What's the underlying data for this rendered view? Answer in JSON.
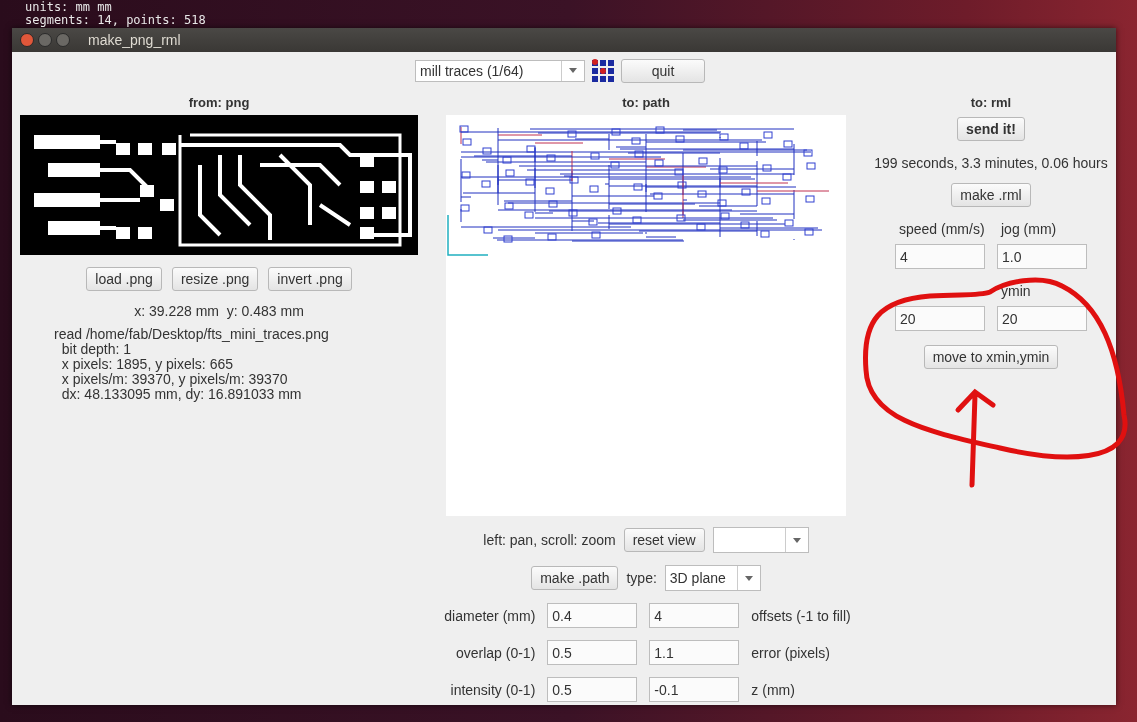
{
  "terminal": {
    "lines": [
      "units: mm mm",
      "segments: 14, points: 518"
    ]
  },
  "window": {
    "title": "make_png_rml"
  },
  "toolbar": {
    "mode_select": {
      "value": "mill traces (1/64)"
    },
    "quit_button": "quit"
  },
  "from_png": {
    "heading": "from: png",
    "buttons": [
      "load .png",
      "resize .png",
      "invert .png"
    ],
    "coords": "x: 39.228 mm  y: 0.483 mm",
    "info_lines": [
      "read /home/fab/Desktop/fts_mini_traces.png",
      "  bit depth: 1",
      "  x pixels: 1895, y pixels: 665",
      "  x pixels/m: 39370, y pixels/m: 39370",
      "  dx: 48.133095 mm, dy: 16.891033 mm"
    ]
  },
  "to_path": {
    "heading": "to: path",
    "view_hint": "left: pan, scroll: zoom",
    "reset_button": "reset view",
    "make_button": "make .path",
    "type_label": "type:",
    "type_select": {
      "value": "3D plane"
    },
    "params": [
      {
        "label": "diameter (mm)",
        "value_1": "0.4",
        "value_2": "4",
        "label_2": "offsets (-1 to fill)"
      },
      {
        "label": "overlap (0-1)",
        "value_1": "0.5",
        "value_2": "1.1",
        "label_2": "error (pixels)"
      },
      {
        "label": "intensity (0-1)",
        "value_1": "0.5",
        "value_2": "-0.1",
        "label_2": "z (mm)"
      }
    ]
  },
  "to_rml": {
    "heading": "to: rml",
    "send_button": "send it!",
    "estimate": "199 seconds, 3.3 minutes, 0.06 hours",
    "make_button": "make .rml",
    "field_rows": [
      {
        "label_1": "speed (mm/s)",
        "label_2": "jog (mm)",
        "value_1": "4",
        "value_2": "1.0"
      },
      {
        "label_2": "ymin",
        "value_1": "20",
        "value_2": "20"
      }
    ],
    "move_button": "move to xmin,ymin"
  }
}
